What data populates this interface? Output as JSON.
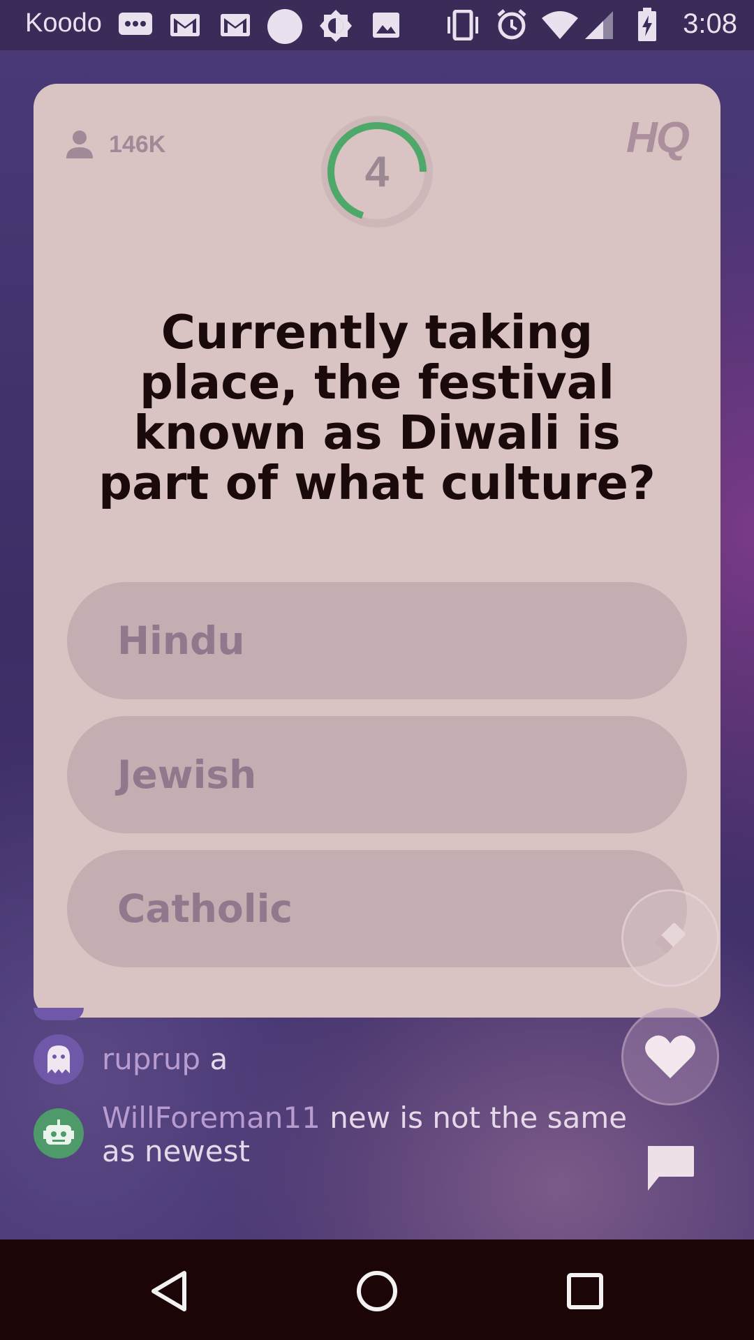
{
  "status_bar": {
    "carrier": "Koodo",
    "time": "3:08",
    "icons": [
      "messages-icon",
      "gmail-icon",
      "gmail-icon",
      "circle-icon",
      "brightness-icon",
      "image-icon",
      "vibrate-icon",
      "alarm-icon",
      "wifi-icon",
      "signal-icon",
      "battery-charging-icon"
    ]
  },
  "game": {
    "viewer_count": "146K",
    "timer_value": "4",
    "timer_progress": 0.7,
    "logo": "HQ",
    "question": "Currently taking place, the festival known as Diwali is part of what culture?",
    "answers": [
      "Hindu",
      "Jewish",
      "Catholic"
    ]
  },
  "chat": {
    "messages": [
      {
        "user": "ruprup",
        "text": "a",
        "avatar": "ghost-icon",
        "avatar_color": "#6f58a8"
      },
      {
        "user": "WillForeman11",
        "text": "new is not the same as newest",
        "avatar": "robot-icon",
        "avatar_color": "#4e9a6a"
      }
    ]
  },
  "colors": {
    "accent_green": "#4ea86a",
    "card": "#d9c3c3",
    "answer_pill": "#c4aeb1"
  }
}
